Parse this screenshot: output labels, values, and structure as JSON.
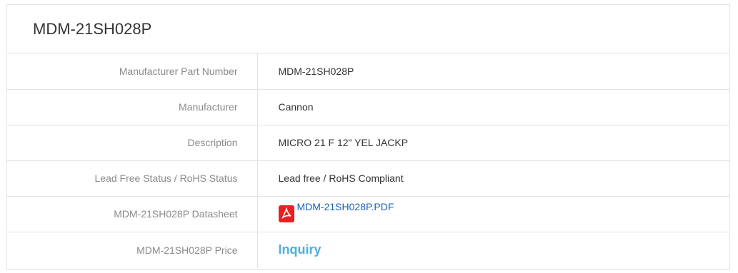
{
  "title": "MDM-21SH028P",
  "rows": [
    {
      "label": "Manufacturer Part Number",
      "value": "MDM-21SH028P"
    },
    {
      "label": "Manufacturer",
      "value": "Cannon"
    },
    {
      "label": "Description",
      "value": "MICRO 21 F 12\" YEL JACKP"
    },
    {
      "label": "Lead Free Status / RoHS Status",
      "value": "Lead free / RoHS Compliant"
    },
    {
      "label": "MDM-21SH028P Datasheet",
      "link_text": "MDM-21SH028P.PDF",
      "icon": "pdf-icon"
    },
    {
      "label": "MDM-21SH028P Price",
      "link_text": "Inquiry"
    }
  ],
  "colors": {
    "pdf_icon": "#e8211f",
    "inquiry_link": "#4ab0d9",
    "datasheet_link": "#1a5fb4"
  }
}
